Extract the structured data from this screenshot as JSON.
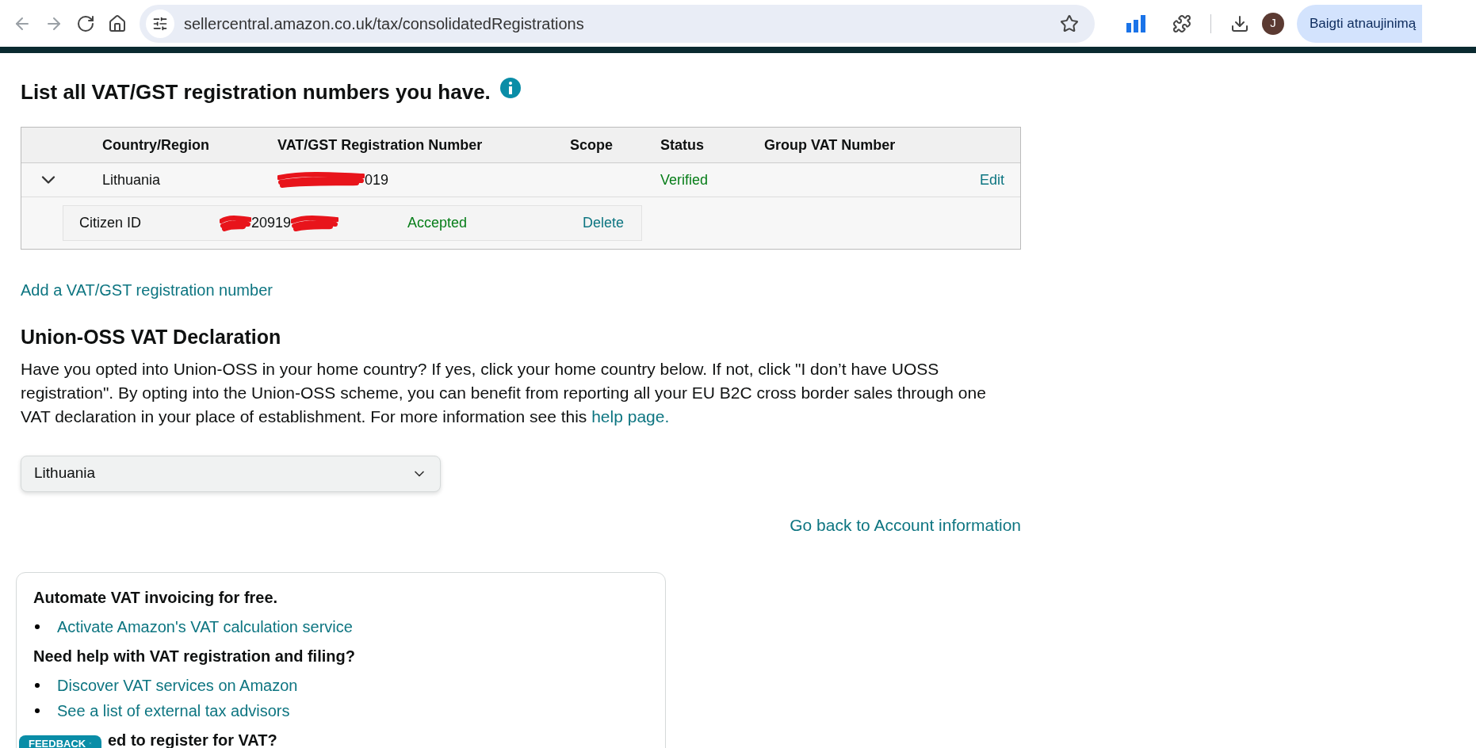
{
  "browser": {
    "url": "sellercentral.amazon.co.uk/tax/consolidatedRegistrations",
    "profile_initial": "J",
    "update_button": "Baigti atnaujinimą"
  },
  "heading": "List all VAT/GST registration numbers you have.",
  "table": {
    "columns": [
      "Country/Region",
      "VAT/GST Registration Number",
      "Scope",
      "Status",
      "Group VAT Number"
    ],
    "rows": [
      {
        "expanded": true,
        "country": "Lithuania",
        "number_visible": "019",
        "redacted": true,
        "scope": "",
        "status": "Verified",
        "action": "Edit",
        "children": [
          {
            "label": "Citizen ID",
            "number_visible": "20919",
            "redacted": true,
            "status": "Accepted",
            "action": "Delete"
          }
        ]
      }
    ]
  },
  "add_link": "Add a VAT/GST registration number",
  "oss": {
    "title": "Union-OSS VAT Declaration",
    "text": "Have you opted into Union-OSS in your home country? If yes, click your home country below. If not, click \"I don’t have UOSS registration\". By opting into the Union-OSS scheme, you can benefit from reporting all your EU B2C cross border sales through one VAT declaration in your place of establishment. For more information see this",
    "link": "help page.",
    "select_value": "Lithuania"
  },
  "back_link": "Go back to Account information",
  "help_card": {
    "sections": [
      {
        "title": "Automate VAT invoicing for free.",
        "links": [
          "Activate Amazon's VAT calculation service"
        ]
      },
      {
        "title": "Need help with VAT registration and filing?",
        "links": [
          "Discover VAT services on Amazon",
          "See a list of external tax advisors"
        ]
      },
      {
        "title": "ed to register for VAT?"
      }
    ]
  },
  "feedback": "FEEDBACK"
}
